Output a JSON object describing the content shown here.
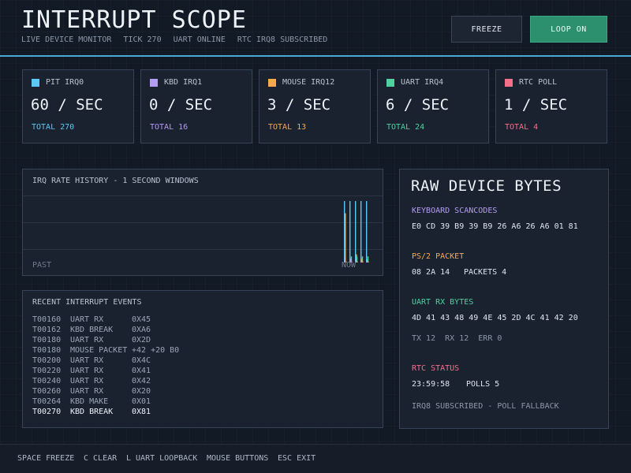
{
  "header": {
    "title": "INTERRUPT SCOPE",
    "status": [
      "LIVE DEVICE MONITOR",
      "TICK 270",
      "UART ONLINE",
      "RTC IRQ8 SUBSCRIBED"
    ],
    "freeze_label": "FREEZE",
    "loop_label": "LOOP ON"
  },
  "cards": [
    {
      "name": "PIT IRQ0",
      "rate": "60 / SEC",
      "total": "TOTAL 270",
      "color": "#5cc8f5"
    },
    {
      "name": "KBD IRQ1",
      "rate": "0 / SEC",
      "total": "TOTAL 16",
      "color": "#b49bf5"
    },
    {
      "name": "MOUSE IRQ12",
      "rate": "3 / SEC",
      "total": "TOTAL 13",
      "color": "#f5a94f"
    },
    {
      "name": "UART IRQ4",
      "rate": "6 / SEC",
      "total": "TOTAL 24",
      "color": "#4fd1a0"
    },
    {
      "name": "RTC POLL",
      "rate": "1 / SEC",
      "total": "TOTAL 4",
      "color": "#f56f8a"
    }
  ],
  "history": {
    "title": "IRQ RATE HISTORY - 1 SECOND WINDOWS",
    "past_label": "PAST",
    "now_label": "NOW"
  },
  "chart_data": {
    "type": "bar",
    "title": "IRQ RATE HISTORY - 1 SECOND WINDOWS",
    "xlabel": "",
    "ylabel": "",
    "x_labels": [
      "PAST",
      "NOW"
    ],
    "windows": 5,
    "series": [
      {
        "name": "PIT IRQ0",
        "color": "#5cc8f5",
        "values": [
          60,
          60,
          60,
          60,
          60
        ]
      },
      {
        "name": "KBD IRQ1",
        "color": "#b49bf5",
        "values": [
          6,
          4,
          4,
          2,
          0
        ]
      },
      {
        "name": "MOUSE IRQ12",
        "color": "#f5a94f",
        "values": [
          48,
          0,
          8,
          4,
          3
        ]
      },
      {
        "name": "UART IRQ4",
        "color": "#4fd1a0",
        "values": [
          0,
          6,
          6,
          6,
          6
        ]
      },
      {
        "name": "RTC POLL",
        "color": "#f56f8a",
        "values": [
          1,
          1,
          1,
          1,
          1
        ]
      }
    ],
    "ylim": [
      0,
      60
    ],
    "grid": true
  },
  "events": {
    "title": "RECENT INTERRUPT EVENTS",
    "rows": [
      {
        "time": "T00160",
        "type": "UART RX",
        "data": "0X45"
      },
      {
        "time": "T00162",
        "type": "KBD BREAK",
        "data": "0XA6"
      },
      {
        "time": "T00180",
        "type": "UART RX",
        "data": "0X2D"
      },
      {
        "time": "T00180",
        "type": "MOUSE PACKET",
        "data": "+42 +20 B0"
      },
      {
        "time": "T00200",
        "type": "UART RX",
        "data": "0X4C"
      },
      {
        "time": "T00220",
        "type": "UART RX",
        "data": "0X41"
      },
      {
        "time": "T00240",
        "type": "UART RX",
        "data": "0X42"
      },
      {
        "time": "T00260",
        "type": "UART RX",
        "data": "0X20"
      },
      {
        "time": "T00264",
        "type": "KBD MAKE",
        "data": "0X01"
      },
      {
        "time": "T00270",
        "type": "KBD BREAK",
        "data": "0X81"
      }
    ]
  },
  "raw": {
    "title": "RAW DEVICE BYTES",
    "kbd_label": "KEYBOARD SCANCODES",
    "kbd_bytes": "E0 CD 39 B9 39 B9 26 A6 26 A6 01 81",
    "ps2_label": "PS/2 PACKET",
    "ps2_bytes": "08 2A 14",
    "ps2_packets": "PACKETS 4",
    "uart_label": "UART RX BYTES",
    "uart_bytes": "4D 41 43 48 49 4E 45 2D 4C 41 42 20",
    "uart_stats": "TX 12  RX 12  ERR 0",
    "rtc_label": "RTC STATUS",
    "rtc_time": "23:59:58",
    "rtc_polls": "POLLS 5",
    "rtc_note": "IRQ8 SUBSCRIBED - POLL FALLBACK"
  },
  "footer": [
    "SPACE FREEZE",
    "C CLEAR",
    "L UART LOOPBACK",
    "MOUSE BUTTONS",
    "ESC EXIT"
  ],
  "colors": {
    "accent": "#4aa8d8",
    "loop_button": "#2c8f6e",
    "kbd": "#b49bf5",
    "ps2": "#f5a94f",
    "uart": "#4fd1a0",
    "rtc": "#f56f8a"
  }
}
